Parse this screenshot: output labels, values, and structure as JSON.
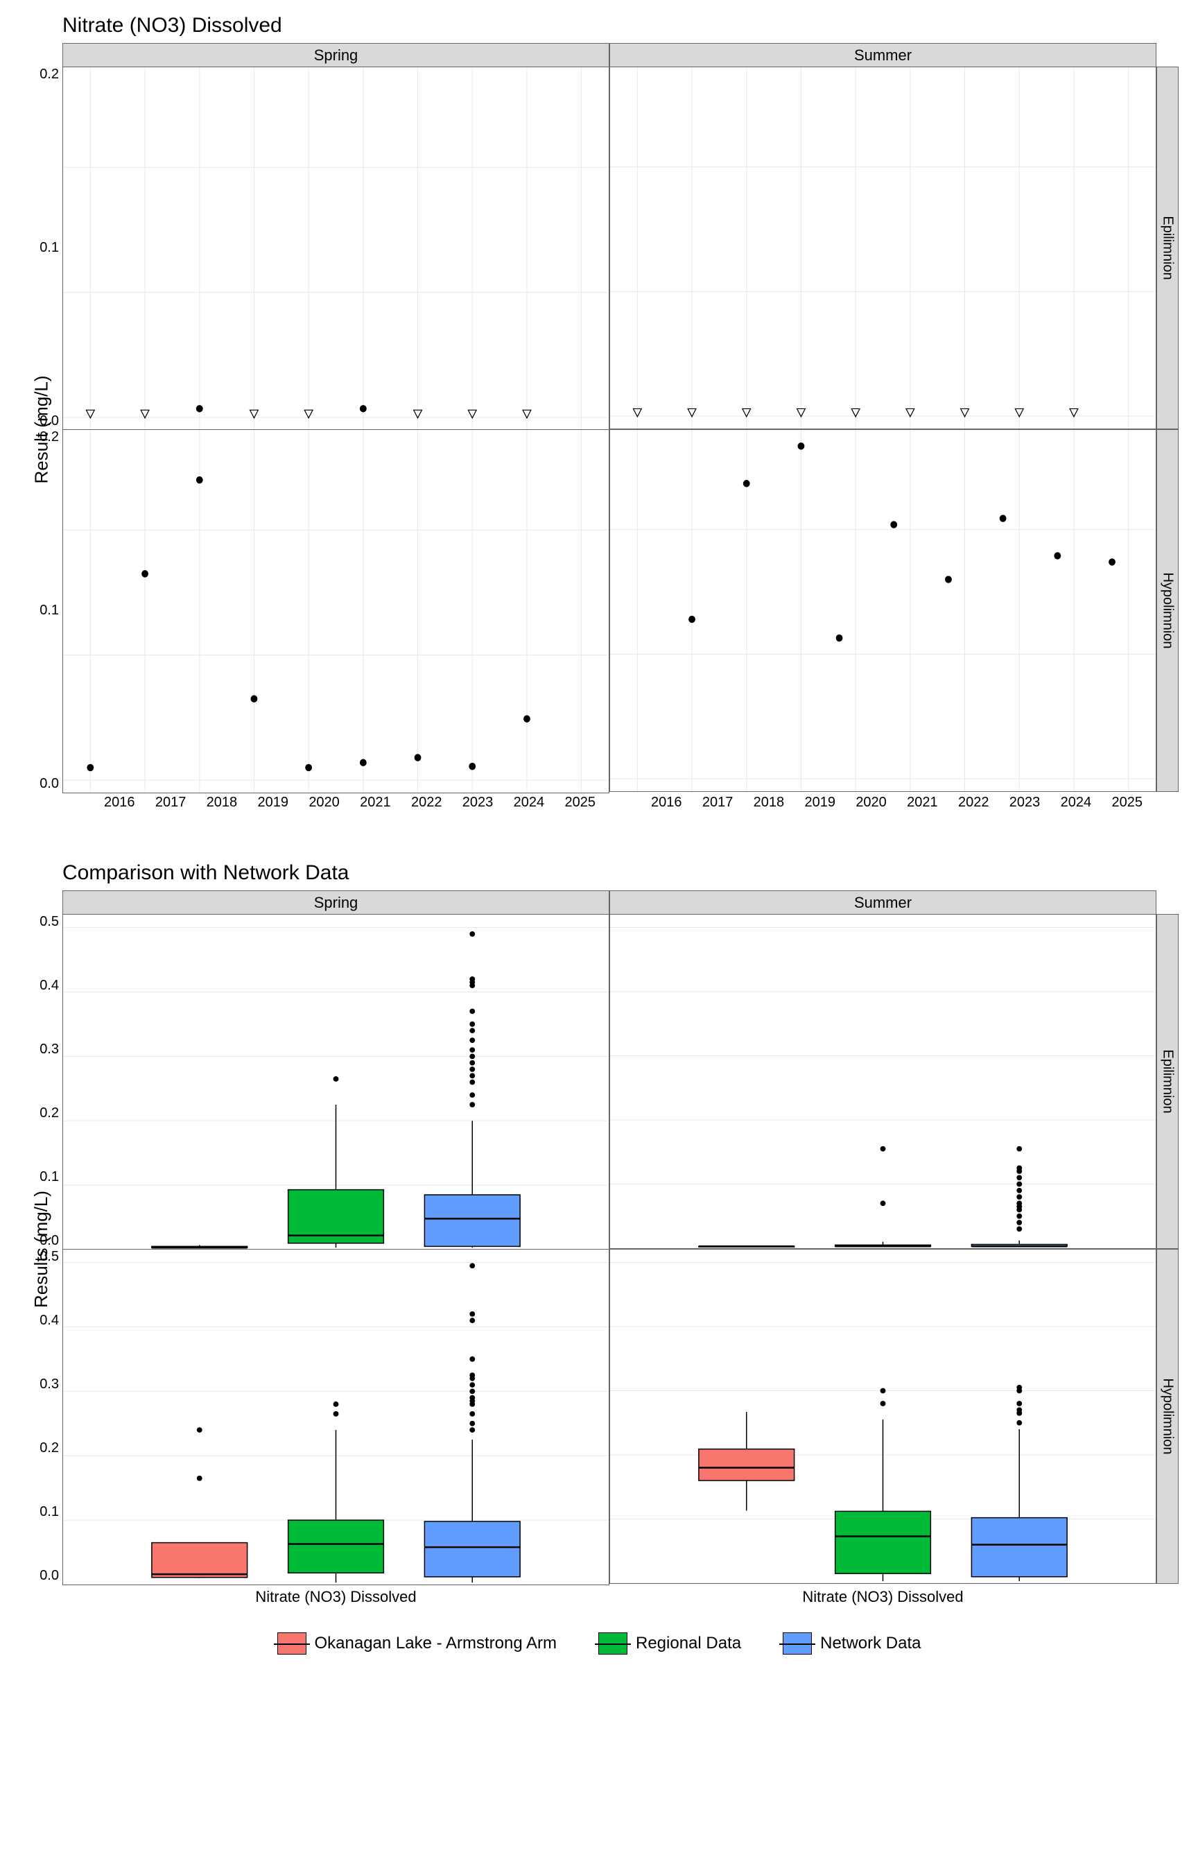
{
  "chart1": {
    "title": "Nitrate (NO3) Dissolved",
    "yaxis": "Result (mg/L)",
    "col_facets": [
      "Spring",
      "Summer"
    ],
    "row_facets": [
      "Epilimnion",
      "Hypolimnion"
    ],
    "x_ticks": [
      "2016",
      "2017",
      "2018",
      "2019",
      "2020",
      "2021",
      "2022",
      "2023",
      "2024",
      "2025"
    ]
  },
  "chart2": {
    "title": "Comparison with Network Data",
    "yaxis": "Results (mg/L)",
    "col_facets": [
      "Spring",
      "Summer"
    ],
    "row_facets": [
      "Epilimnion",
      "Hypolimnion"
    ],
    "x_category": "Nitrate (NO3) Dissolved"
  },
  "legend": {
    "items": [
      {
        "label": "Okanagan Lake - Armstrong Arm",
        "color": "#F8766D"
      },
      {
        "label": "Regional Data",
        "color": "#00BA38"
      },
      {
        "label": "Network Data",
        "color": "#619CFF"
      }
    ]
  },
  "chart_data": [
    {
      "type": "scatter",
      "title": "Nitrate (NO3) Dissolved",
      "xlabel": "",
      "ylabel": "Result (mg/L)",
      "ylim": [
        -0.01,
        0.28
      ],
      "x": [
        2016,
        2017,
        2018,
        2019,
        2020,
        2021,
        2022,
        2023,
        2024
      ],
      "facets": {
        "Spring|Epilimnion": {
          "values": [
            0.003,
            0.003,
            0.007,
            0.003,
            0.003,
            0.007,
            0.003,
            0.003,
            0.003
          ],
          "censored": [
            true,
            true,
            false,
            true,
            true,
            false,
            true,
            true,
            true
          ]
        },
        "Summer|Epilimnion": {
          "values": [
            0.003,
            0.003,
            0.003,
            0.003,
            0.003,
            0.003,
            0.003,
            0.003,
            0.003
          ],
          "censored": [
            true,
            true,
            true,
            true,
            true,
            true,
            true,
            true,
            true
          ]
        },
        "Spring|Hypolimnion": {
          "values": [
            0.01,
            0.165,
            0.24,
            0.065,
            0.01,
            0.014,
            0.018,
            0.011,
            0.049
          ],
          "censored": [
            false,
            false,
            false,
            false,
            false,
            false,
            false,
            false,
            false
          ]
        },
        "Summer|Hypolimnion": {
          "values": [
            null,
            0.128,
            0.237,
            0.267,
            0.113,
            0.204,
            0.16,
            0.209,
            0.179,
            0.174
          ],
          "x": [
            2016,
            2017,
            2018,
            2019,
            2019.7,
            2020.7,
            2021.7,
            2022.7,
            2023.7,
            2024.7
          ],
          "censored": [
            false,
            false,
            false,
            false,
            false,
            false,
            false,
            false,
            false,
            false
          ]
        }
      },
      "note": "open triangles = below detection (censored=true); filled circles = detected"
    },
    {
      "type": "boxplot",
      "title": "Comparison with Network Data",
      "xlabel": "",
      "ylabel": "Results (mg/L)",
      "ylim": [
        0,
        0.52
      ],
      "categories": [
        "Nitrate (NO3) Dissolved"
      ],
      "groups": [
        "Okanagan Lake - Armstrong Arm",
        "Regional Data",
        "Network Data"
      ],
      "colors": [
        "#F8766D",
        "#00BA38",
        "#619CFF"
      ],
      "facets": {
        "Spring|Epilimnion": {
          "boxes": [
            {
              "min": 0.003,
              "q1": 0.003,
              "median": 0.003,
              "q3": 0.005,
              "max": 0.007,
              "outliers": []
            },
            {
              "min": 0.003,
              "q1": 0.01,
              "median": 0.022,
              "q3": 0.093,
              "max": 0.225,
              "outliers": [
                0.265
              ]
            },
            {
              "min": 0.003,
              "q1": 0.005,
              "median": 0.048,
              "q3": 0.085,
              "max": 0.2,
              "outliers": [
                0.225,
                0.24,
                0.26,
                0.27,
                0.28,
                0.29,
                0.3,
                0.31,
                0.325,
                0.34,
                0.35,
                0.37,
                0.41,
                0.415,
                0.42,
                0.49
              ]
            }
          ]
        },
        "Summer|Epilimnion": {
          "boxes": [
            {
              "min": 0.003,
              "q1": 0.003,
              "median": 0.003,
              "q3": 0.003,
              "max": 0.003,
              "outliers": []
            },
            {
              "min": 0.003,
              "q1": 0.003,
              "median": 0.003,
              "q3": 0.005,
              "max": 0.01,
              "outliers": [
                0.07,
                0.155
              ]
            },
            {
              "min": 0.003,
              "q1": 0.003,
              "median": 0.003,
              "q3": 0.006,
              "max": 0.012,
              "outliers": [
                0.03,
                0.04,
                0.05,
                0.06,
                0.065,
                0.07,
                0.08,
                0.09,
                0.1,
                0.11,
                0.12,
                0.125,
                0.155
              ]
            }
          ]
        },
        "Spring|Hypolimnion": {
          "boxes": [
            {
              "min": 0.01,
              "q1": 0.011,
              "median": 0.016,
              "q3": 0.065,
              "max": 0.065,
              "outliers": [
                0.165,
                0.24
              ]
            },
            {
              "min": 0.003,
              "q1": 0.018,
              "median": 0.063,
              "q3": 0.1,
              "max": 0.24,
              "outliers": [
                0.265,
                0.28
              ]
            },
            {
              "min": 0.003,
              "q1": 0.012,
              "median": 0.058,
              "q3": 0.098,
              "max": 0.225,
              "outliers": [
                0.24,
                0.25,
                0.265,
                0.28,
                0.285,
                0.29,
                0.3,
                0.31,
                0.32,
                0.325,
                0.35,
                0.41,
                0.42,
                0.495
              ]
            }
          ]
        },
        "Summer|Hypolimnion": {
          "boxes": [
            {
              "min": 0.113,
              "q1": 0.16,
              "median": 0.18,
              "q3": 0.209,
              "max": 0.267,
              "outliers": []
            },
            {
              "min": 0.003,
              "q1": 0.015,
              "median": 0.073,
              "q3": 0.112,
              "max": 0.255,
              "outliers": [
                0.28,
                0.3
              ]
            },
            {
              "min": 0.003,
              "q1": 0.01,
              "median": 0.06,
              "q3": 0.102,
              "max": 0.24,
              "outliers": [
                0.25,
                0.265,
                0.27,
                0.28,
                0.3,
                0.305
              ]
            }
          ]
        }
      }
    }
  ]
}
